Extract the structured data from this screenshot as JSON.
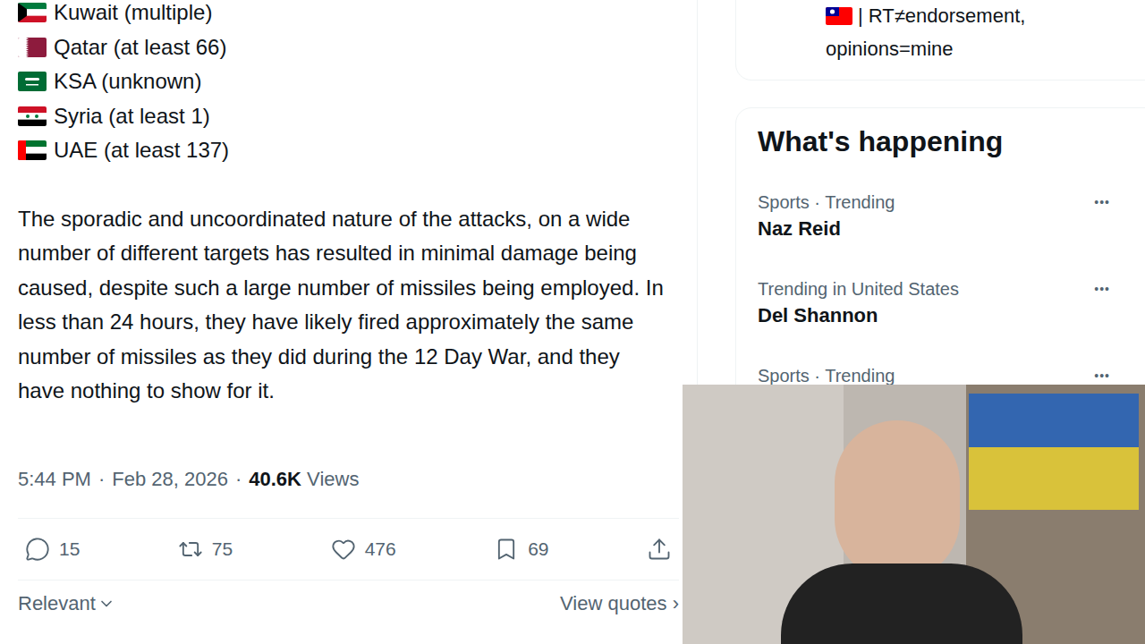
{
  "post": {
    "flags": [
      {
        "kind": "kuwait",
        "label": "Kuwait (multiple)"
      },
      {
        "kind": "qatar",
        "label": "Qatar (at least 66)"
      },
      {
        "kind": "ksa",
        "label": "KSA (unknown)"
      },
      {
        "kind": "syria",
        "label": "Syria (at least 1)"
      },
      {
        "kind": "uae",
        "label": "UAE (at least 137)"
      }
    ],
    "body": "The sporadic and uncoordinated nature of the attacks, on a wide number of different targets has resulted in minimal damage being caused, despite such a large number of missiles being employed. In less than 24 hours, they have likely fired approximately the same number of missiles as they did during the 12 Day War, and they have nothing to show for it.",
    "meta": {
      "time": "5:44 PM",
      "separator": "·",
      "date": "Feb 28, 2026",
      "views_count": "40.6K",
      "views_label": "Views"
    },
    "actions": [
      {
        "kind": "reply",
        "count": "15"
      },
      {
        "kind": "repost",
        "count": "75"
      },
      {
        "kind": "like",
        "count": "476"
      },
      {
        "kind": "bookmark",
        "count": "69"
      },
      {
        "kind": "share",
        "count": ""
      }
    ],
    "sort": "Relevant",
    "quotes_link": "View quotes ›"
  },
  "profile_card": {
    "lines": [
      "| RT≠endorsement,",
      "opinions=mine"
    ]
  },
  "trends": {
    "title": "What's happening",
    "items": [
      {
        "context": "Sports · Trending",
        "name": "Naz Reid",
        "more": "•••"
      },
      {
        "context": "Trending in United States",
        "name": "Del Shannon",
        "more": "•••"
      },
      {
        "context": "Sports · Trending",
        "name": "",
        "more": "•••"
      }
    ]
  }
}
